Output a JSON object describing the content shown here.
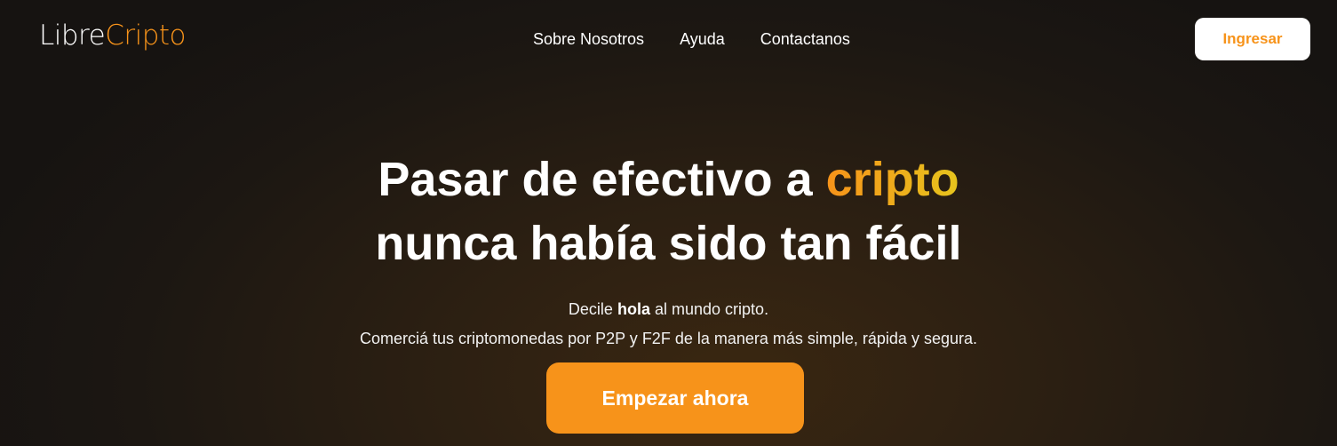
{
  "header": {
    "logo": {
      "text_main": "Libre",
      "text_accent": "Cripto"
    },
    "nav": [
      {
        "label": "Sobre Nosotros"
      },
      {
        "label": "Ayuda"
      },
      {
        "label": "Contactanos"
      }
    ],
    "login_label": "Ingresar"
  },
  "hero": {
    "title_line1_prefix": "Pasar de efectivo a",
    "title_line1_highlight": "cripto",
    "title_line2": "nunca había sido tan fácil",
    "sub_line1_prefix": "Decile",
    "sub_line1_bold": "hola",
    "sub_line1_suffix": "al mundo cripto.",
    "sub_line2": "Comerciá tus criptomonedas por P2P y F2F de la manera más simple, rápida y segura.",
    "cta_label": "Empezar ahora"
  },
  "colors": {
    "accent": "#f7931a",
    "accent_gradient_end": "#e6c41d",
    "background": "#1c1712",
    "button_white": "#ffffff"
  }
}
